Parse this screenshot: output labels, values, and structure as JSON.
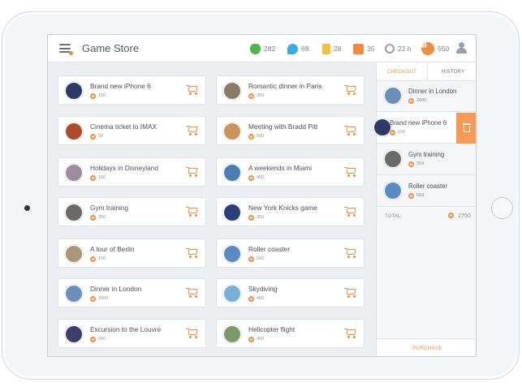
{
  "app": {
    "title": "Game Store"
  },
  "stats": [
    {
      "icon": "hand-icon",
      "value": "282",
      "color": "#4cb648"
    },
    {
      "icon": "chat-bubble-icon",
      "value": "69",
      "color": "#3aa9e8"
    },
    {
      "icon": "document-icon",
      "value": "28",
      "color": "#f3c13a"
    },
    {
      "icon": "wallet-icon",
      "value": "35",
      "color": "#f28c3c"
    },
    {
      "icon": "clock-icon",
      "value": "22 h",
      "color": "#9aa0a8"
    },
    {
      "icon": "coin-icon",
      "badge": "M",
      "value": "550",
      "color": "#f28c3c"
    }
  ],
  "products": [
    {
      "name": "Brand new iPhone 6",
      "price": "150",
      "thumb": "#2b3a66"
    },
    {
      "name": "Romantic dinner in Paris",
      "price": "350",
      "thumb": "#8a7a6a"
    },
    {
      "name": "Cinema ticket to IMAX",
      "price": "50",
      "thumb": "#b04a2a"
    },
    {
      "name": "Meeting with Bradd Pitt",
      "price": "500",
      "thumb": "#c8955c"
    },
    {
      "name": "Holidays in Disneyland",
      "price": "150",
      "thumb": "#9c8c9c"
    },
    {
      "name": "A weekends in Miami",
      "price": "400",
      "thumb": "#4a7fb5"
    },
    {
      "name": "Gym training",
      "price": "350",
      "thumb": "#6b6a66"
    },
    {
      "name": "New York Knicks game",
      "price": "300",
      "thumb": "#2a3f7a"
    },
    {
      "name": "A tour of Berlin",
      "price": "150",
      "thumb": "#a89878"
    },
    {
      "name": "Roller coaster",
      "price": "500",
      "thumb": "#5a8ac4"
    },
    {
      "name": "Dinner in London",
      "price": "2000",
      "thumb": "#6b8fb8"
    },
    {
      "name": "Skydiving",
      "price": "400",
      "thumb": "#7ab0d8"
    },
    {
      "name": "Excursion to the Louvre",
      "price": "200",
      "thumb": "#3a3f6a"
    },
    {
      "name": "Helicopter flight",
      "price": "300",
      "thumb": "#7a9a6a"
    }
  ],
  "panel": {
    "tabs": [
      "CHECKOUT",
      "HISTORY"
    ],
    "items": [
      {
        "name": "Dinner in London",
        "price": "2000",
        "thumb": "#6b8fb8"
      },
      {
        "name": "Brand new iPhone 6",
        "price": "150",
        "thumb": "#2b3a66"
      },
      {
        "name": "Gym training",
        "price": "350",
        "thumb": "#6b6a66"
      },
      {
        "name": "Roller coaster",
        "price": "500",
        "thumb": "#5a8ac4"
      }
    ],
    "total_label": "TOTAL:",
    "total_value": "2750",
    "purchase_label": "PURCHASE"
  },
  "coin_symbol": "M",
  "colors": {
    "accent": "#f28c3c",
    "delete": "#f79a56"
  }
}
